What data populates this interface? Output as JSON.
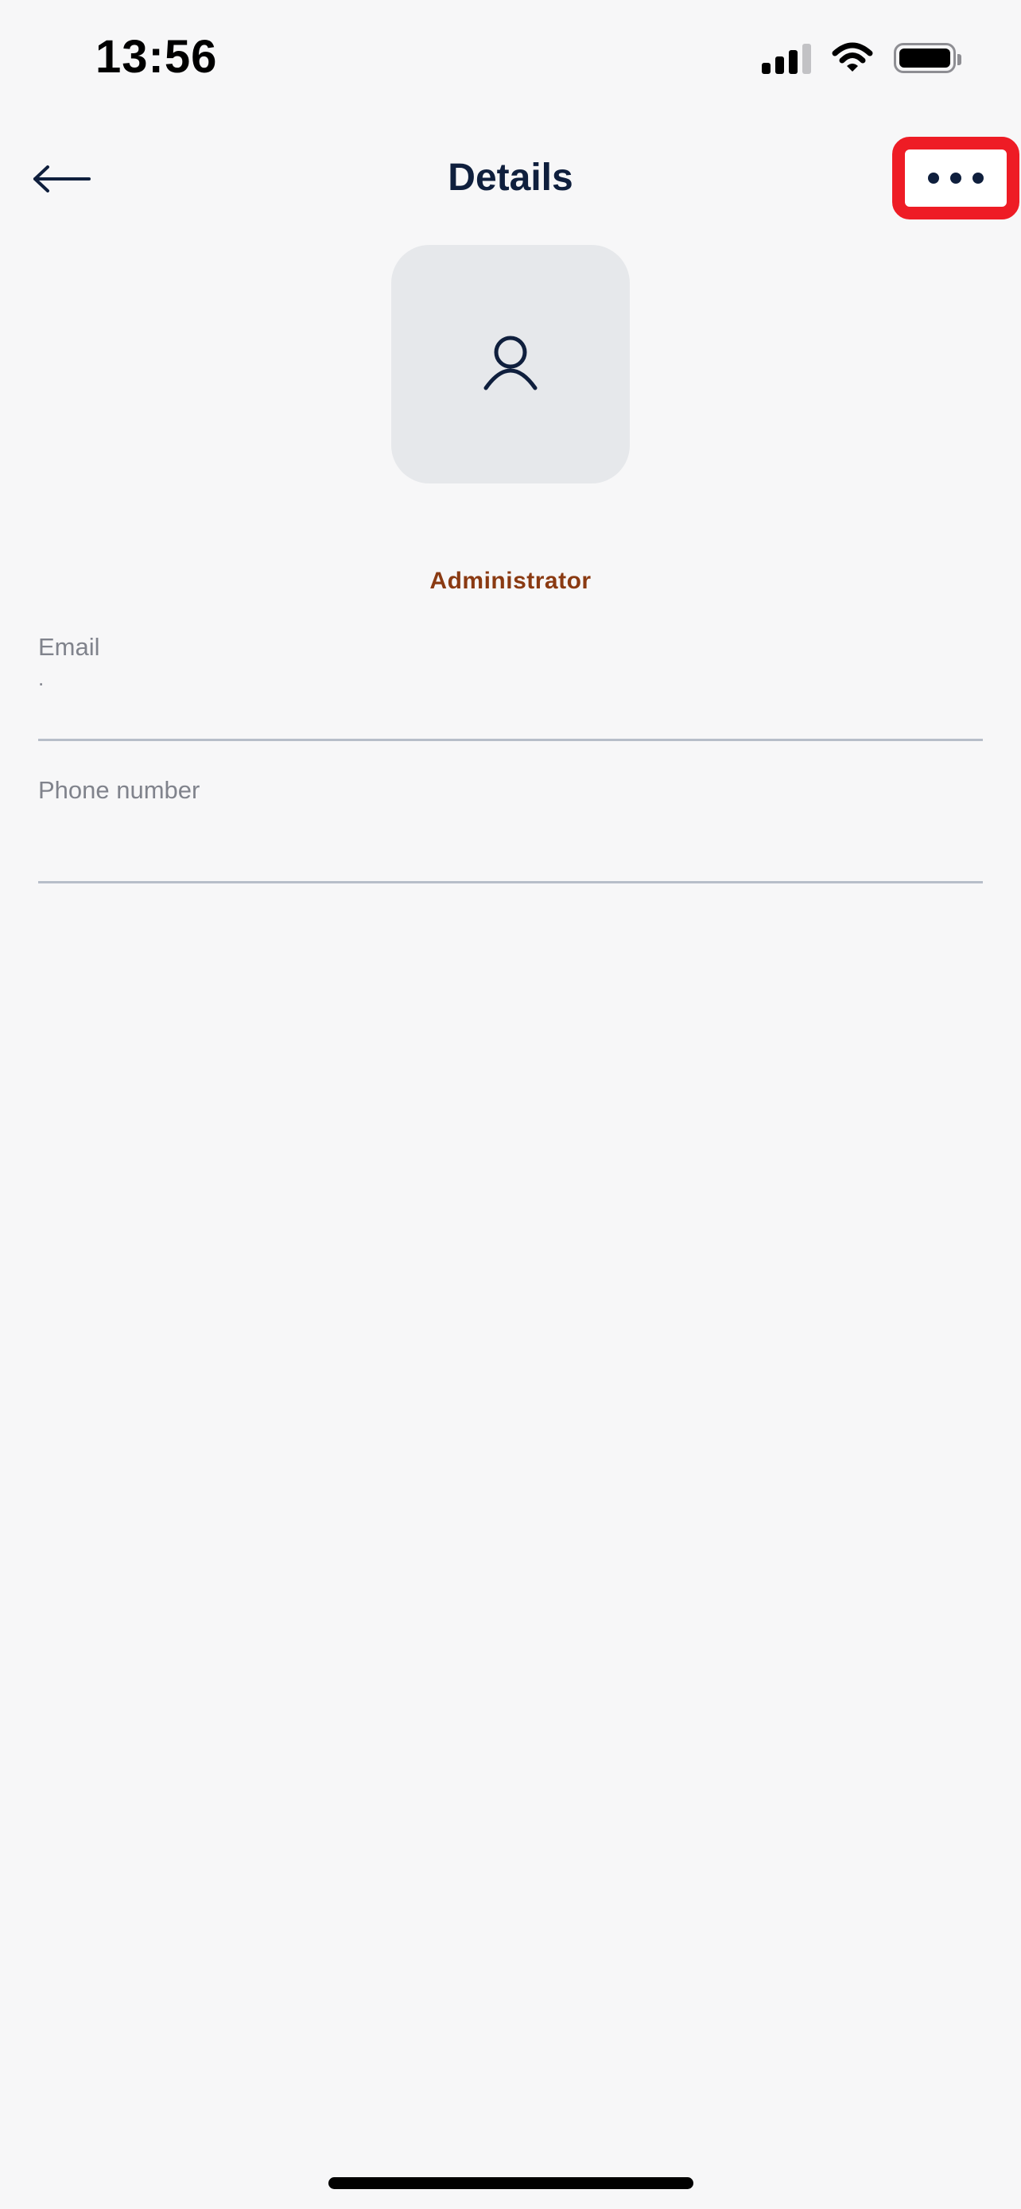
{
  "status_bar": {
    "time": "13:56",
    "icons": [
      "cellular-signal-icon",
      "wifi-icon",
      "battery-icon"
    ]
  },
  "header": {
    "title": "Details",
    "back_icon": "arrow-left-icon",
    "more_icon": "more-horizontal-icon"
  },
  "profile": {
    "avatar_icon": "user-icon",
    "role": "Administrator"
  },
  "fields": {
    "email": {
      "label": "Email",
      "value": "."
    },
    "phone": {
      "label": "Phone number",
      "value": ""
    }
  },
  "colors": {
    "background": "#f7f7f8",
    "title": "#0f1f3d",
    "role": "#8a3a12",
    "highlight": "#ee1c25",
    "avatar_bg": "#e6e8eb",
    "divider": "#b7bec9"
  }
}
